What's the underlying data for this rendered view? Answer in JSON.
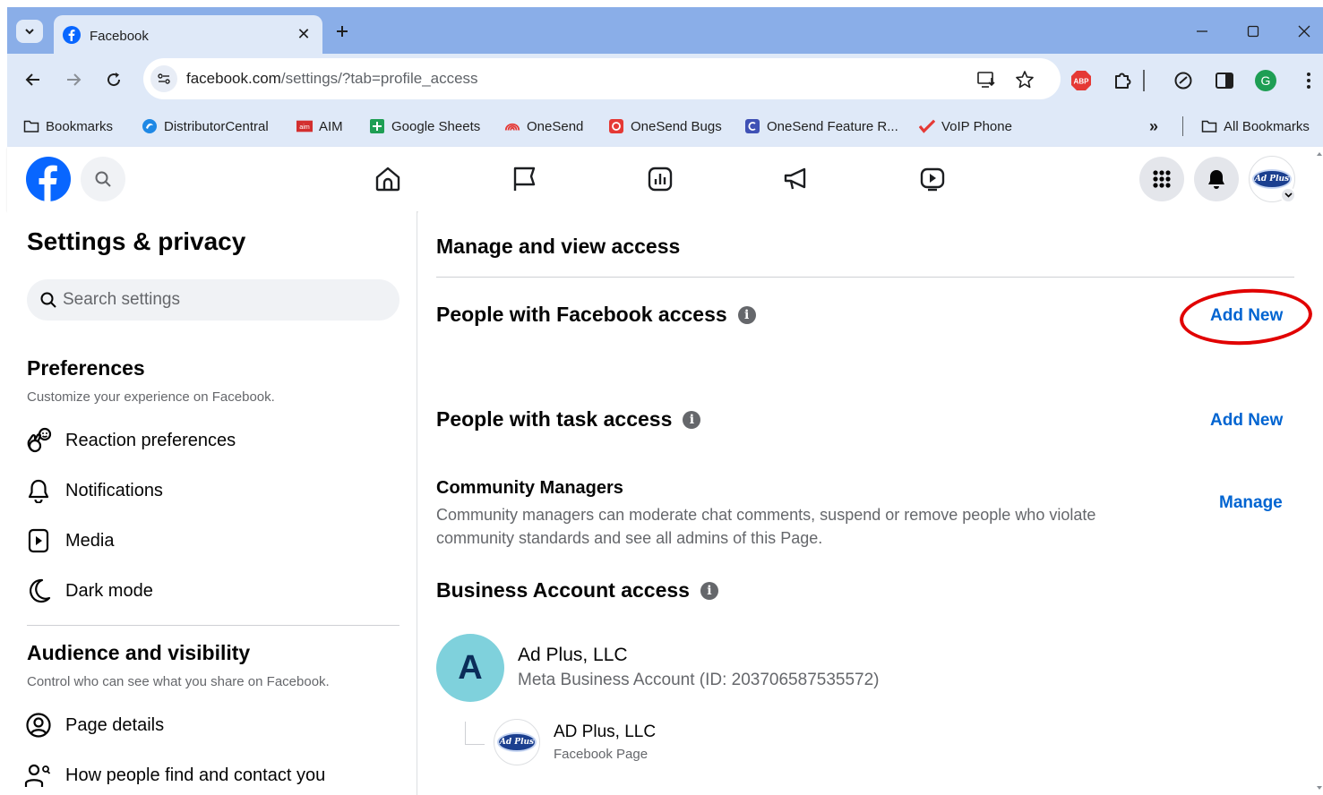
{
  "browser": {
    "tab": {
      "title": "Facebook"
    },
    "address": {
      "host": "facebook.com",
      "path": "/settings/?tab=profile_access"
    },
    "bookmarks": [
      {
        "label": "Bookmarks",
        "icon": "folder-icon"
      },
      {
        "label": "DistributorCentral",
        "icon": "distributorcentral-icon"
      },
      {
        "label": "AIM",
        "icon": "aim-icon"
      },
      {
        "label": "Google Sheets",
        "icon": "google-sheets-icon"
      },
      {
        "label": "OneSend",
        "icon": "onesend-icon"
      },
      {
        "label": "OneSend Bugs",
        "icon": "onesend-bugs-icon"
      },
      {
        "label": "OneSend Feature R...",
        "icon": "onesend-feature-icon"
      },
      {
        "label": "VoIP Phone",
        "icon": "voip-phone-icon"
      }
    ],
    "all_bookmarks": "All Bookmarks",
    "overflow": "»",
    "extensions": {
      "abp": "ABP",
      "profile_initial": "G"
    },
    "colors": {
      "tabstrip": "#8aaee8",
      "toolbar": "#dfe9f8"
    }
  },
  "facebook": {
    "brand_color": "#0866ff",
    "avatar_text": "Ad Plus"
  },
  "sidebar": {
    "title": "Settings & privacy",
    "search_placeholder": "Search settings",
    "preferences": {
      "title": "Preferences",
      "subtitle": "Customize your experience on Facebook.",
      "items": [
        {
          "label": "Reaction preferences",
          "icon": "reaction-preferences-icon"
        },
        {
          "label": "Notifications",
          "icon": "bell-icon"
        },
        {
          "label": "Media",
          "icon": "media-icon"
        },
        {
          "label": "Dark mode",
          "icon": "moon-icon"
        }
      ]
    },
    "audience": {
      "title": "Audience and visibility",
      "subtitle": "Control who can see what you share on Facebook.",
      "items": [
        {
          "label": "Page details",
          "icon": "person-circle-icon"
        },
        {
          "label": "How people find and contact you",
          "icon": "find-people-icon"
        }
      ]
    }
  },
  "main": {
    "title": "Manage and view access",
    "facebook_access": {
      "label": "People with Facebook access",
      "action": "Add New"
    },
    "task_access": {
      "label": "People with task access",
      "action": "Add New"
    },
    "community_managers": {
      "title": "Community Managers",
      "description": "Community managers can moderate chat comments, suspend or remove people who violate community standards and see all admins of this Page.",
      "action": "Manage"
    },
    "business_access": {
      "label": "Business Account access",
      "account": {
        "initial": "A",
        "name": "Ad Plus, LLC",
        "detail": "Meta Business Account (ID: 203706587535572)"
      },
      "page": {
        "name": "AD Plus, LLC",
        "type": "Facebook Page",
        "logo_text": "Ad Plus"
      }
    },
    "annotation_color": "#e10000"
  }
}
